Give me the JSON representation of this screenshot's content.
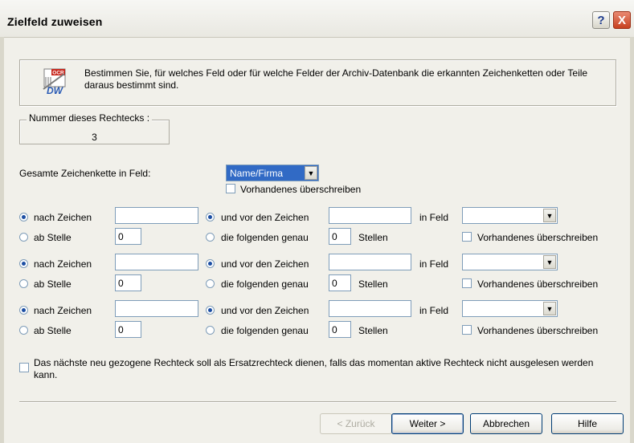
{
  "window": {
    "title": "Zielfeld zuweisen",
    "help_glyph": "?",
    "close_glyph": "X"
  },
  "info": {
    "icon": "ocr-dw-icon",
    "icon_label_top": "OCR",
    "icon_label_bottom": "DW",
    "text": "Bestimmen Sie, für welches Feld oder für welche Felder der Archiv-Datenbank die erkannten Zeichenketten oder Teile daraus bestimmt sind."
  },
  "number_group": {
    "legend": "Nummer dieses Rechtecks :",
    "value": "3"
  },
  "whole_string": {
    "label": "Gesamte Zeichenkette in Feld:",
    "selected": "Name/Firma",
    "overwrite_label": "Vorhandenes überschreiben"
  },
  "rules": [
    {
      "after_chars_label": "nach Zeichen",
      "after_chars_value": "",
      "from_pos_label": "ab Stelle",
      "from_pos_value": "0",
      "before_chars_label": "und vor den Zeichen",
      "before_chars_value": "",
      "following_label": "die folgenden genau",
      "following_value": "0",
      "positions_label": "Stellen",
      "in_field_label": "in Feld",
      "in_field_value": "",
      "overwrite_label": "Vorhandenes überschreiben"
    },
    {
      "after_chars_label": "nach Zeichen",
      "after_chars_value": "",
      "from_pos_label": "ab Stelle",
      "from_pos_value": "0",
      "before_chars_label": "und vor den Zeichen",
      "before_chars_value": "",
      "following_label": "die folgenden genau",
      "following_value": "0",
      "positions_label": "Stellen",
      "in_field_label": "in Feld",
      "in_field_value": "",
      "overwrite_label": "Vorhandenes überschreiben"
    },
    {
      "after_chars_label": "nach Zeichen",
      "after_chars_value": "",
      "from_pos_label": "ab Stelle",
      "from_pos_value": "0",
      "before_chars_label": "und vor den Zeichen",
      "before_chars_value": "",
      "following_label": "die folgenden genau",
      "following_value": "0",
      "positions_label": "Stellen",
      "in_field_label": "in Feld",
      "in_field_value": "",
      "overwrite_label": "Vorhandenes überschreiben"
    }
  ],
  "fallback": {
    "text": "Das nächste neu gezogene Rechteck soll als Ersatzrechteck dienen, falls das momentan aktive Rechteck nicht ausgelesen werden kann."
  },
  "buttons": {
    "back": "< Zurück",
    "next": "Weiter >",
    "cancel": "Abbrechen",
    "help": "Hilfe"
  },
  "colors": {
    "dialog_bg": "#f1f0ea",
    "field_border": "#7f9db9",
    "selection": "#316ac5",
    "close_red": "#c7401f"
  }
}
